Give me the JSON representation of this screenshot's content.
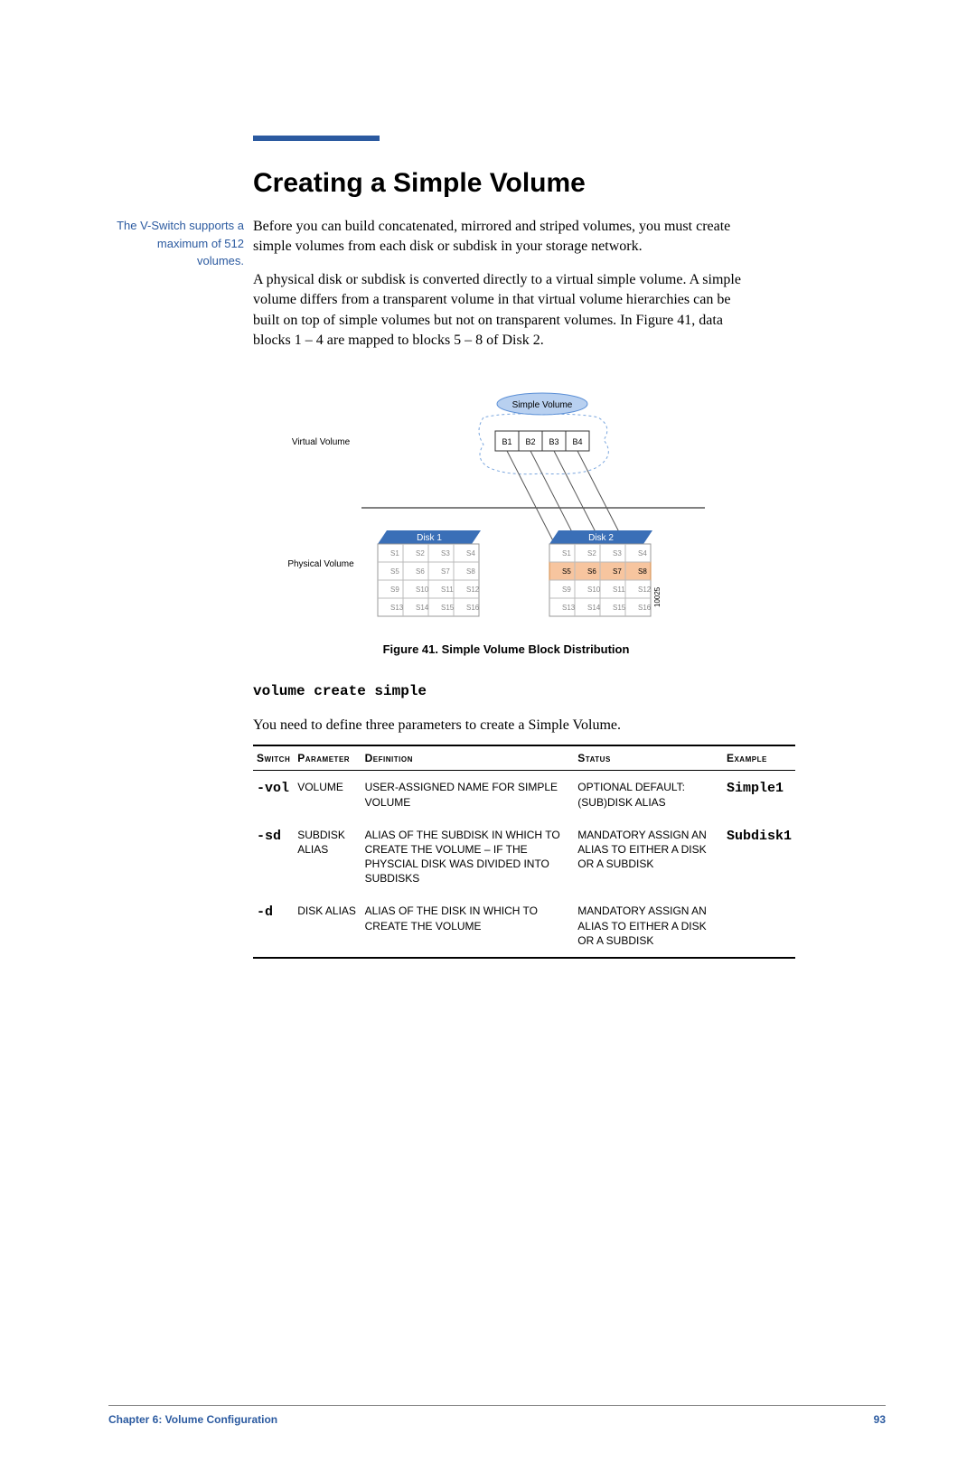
{
  "heading": "Creating a Simple Volume",
  "side_note": "The V-Switch supports a maximum of 512 volumes.",
  "paragraphs": {
    "p1": "Before you can build concatenated, mirrored and striped volumes, you must create simple volumes from each disk or subdisk in your storage network.",
    "p2": "A physical disk or subdisk is converted directly to a virtual simple volume. A simple volume differs from a transparent volume in that virtual volume hierarchies can be built on top of simple volumes but not on transparent volumes.  In Figure 41, data blocks 1 – 4 are mapped to blocks 5 – 8 of Disk 2."
  },
  "figure": {
    "virtual_label": "Virtual Volume",
    "physical_label": "Physical Volume",
    "simple_volume": "Simple Volume",
    "disk1": "Disk 1",
    "disk2": "Disk 2",
    "blocks": [
      "B1",
      "B2",
      "B3",
      "B4"
    ],
    "caption": "Figure 41.      Simple Volume Block Distribution",
    "side_id": "10025"
  },
  "command": "volume create simple",
  "lead_in": "You need to define three parameters to create a Simple Volume.",
  "table": {
    "headers": [
      "Switch",
      "Parameter",
      "Definition",
      "Status",
      "Example"
    ],
    "rows": [
      {
        "switch": "-vol",
        "param": "VOLUME",
        "def": "USER-ASSIGNED NAME FOR SIMPLE VOLUME",
        "status": "OPTIONAL DEFAULT: (SUB)DISK ALIAS",
        "example": "Simple1"
      },
      {
        "switch": "-sd",
        "param": "SUBDISK ALIAS",
        "def": "ALIAS OF THE SUBDISK IN WHICH TO CREATE THE VOLUME – IF THE PHYSCIAL DISK WAS DIVIDED INTO SUBDISKS",
        "status": "MANDATORY ASSIGN AN ALIAS TO EITHER A DISK OR A SUBDISK",
        "example": "Subdisk1"
      },
      {
        "switch": "-d",
        "param": "DISK ALIAS",
        "def": "ALIAS OF THE DISK IN WHICH TO CREATE THE VOLUME",
        "status": "MANDATORY ASSIGN AN ALIAS TO EITHER A DISK OR A SUBDISK",
        "example": ""
      }
    ]
  },
  "footer": {
    "chapter": "Chapter 6:  Volume Configuration",
    "page": "93"
  }
}
